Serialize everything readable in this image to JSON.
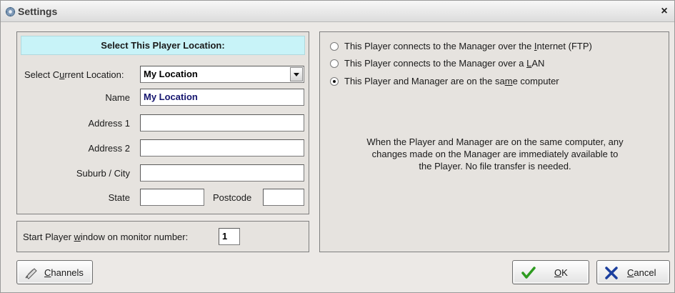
{
  "window": {
    "title": "Settings"
  },
  "location_panel": {
    "header": "Select This Player Location:",
    "select_current_location": {
      "label_pre": "Select C",
      "label_key": "u",
      "label_post": "rrent Location:",
      "value": "My Location"
    },
    "name": {
      "label": "Name",
      "value": "My Location"
    },
    "address1": {
      "label": "Address 1",
      "value": ""
    },
    "address2": {
      "label": "Address 2",
      "value": ""
    },
    "suburb": {
      "label": "Suburb / City",
      "value": ""
    },
    "state": {
      "label": "State",
      "value": ""
    },
    "postcode": {
      "label": "Postcode",
      "value": ""
    }
  },
  "monitor_panel": {
    "label_pre": "Start Player ",
    "label_key": "w",
    "label_post": "indow on monitor number:",
    "value": "1"
  },
  "connection_panel": {
    "options": [
      {
        "pre": "This Player connects to the Manager over the ",
        "key": "I",
        "post": "nternet (FTP)",
        "selected": false
      },
      {
        "pre": "This Player connects to the Manager over a ",
        "key": "L",
        "post": "AN",
        "selected": false
      },
      {
        "pre": "This Player and Manager are on the sa",
        "key": "m",
        "post": "e computer",
        "selected": true
      }
    ],
    "info_lines": [
      "When the Player and Manager are on the same computer, any",
      "changes made on the Manager are immediately available to",
      "the Player. No file transfer is needed."
    ]
  },
  "buttons": {
    "channels": {
      "key": "C",
      "rest": "hannels"
    },
    "ok": {
      "key": "O",
      "rest": "K"
    },
    "cancel": {
      "key": "C",
      "rest": "ancel"
    }
  },
  "colors": {
    "header_bg": "#c8f3f8",
    "ok_icon": "#2e9b1f",
    "cancel_icon": "#1c3f9e"
  }
}
